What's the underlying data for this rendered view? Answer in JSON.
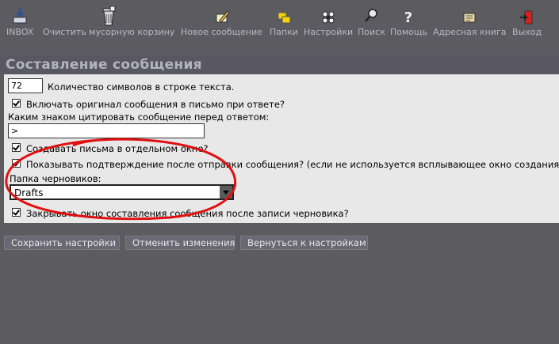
{
  "toolbar": {
    "items": [
      {
        "label": "INBOX",
        "icon": "inbox-icon"
      },
      {
        "label": "Очистить мусорную корзину",
        "icon": "trash-icon"
      },
      {
        "label": "Новое сообщение",
        "icon": "compose-icon"
      },
      {
        "label": "Папки",
        "icon": "folders-icon"
      },
      {
        "label": "Настройки",
        "icon": "settings-icon"
      },
      {
        "label": "Поиск",
        "icon": "search-icon"
      },
      {
        "label": "Помощь",
        "icon": "help-icon"
      },
      {
        "label": "Адресная книга",
        "icon": "addressbook-icon"
      },
      {
        "label": "Выход",
        "icon": "logout-icon"
      }
    ]
  },
  "section": {
    "title": "Составление сообщения"
  },
  "form": {
    "line_width_value": "72",
    "line_width_label": "Количество символов в строке текста.",
    "include_original_label": "Включать оригинал сообщения в письмо при ответе?",
    "quote_char_label": "Каким знаком цитировать сообщение перед ответом:",
    "quote_char_value": ">",
    "separate_window_label": "Создавать письма в отдельном окне?",
    "show_confirmation_label": "Показывать подтверждение после отправки сообщения? (если не используется всплывающее окно создания сообще",
    "drafts_folder_label": "Папка черновиков:",
    "drafts_folder_value": "Drafts",
    "close_after_save_label": "Закрывать окно составления сообщения после записи черновика?"
  },
  "buttons": {
    "save": "Сохранить настройки",
    "cancel": "Отменить изменения",
    "back": "Вернуться к настройкам"
  },
  "colors": {
    "background": "#5c5b60",
    "panel": "#e9e8e8",
    "annotation": "#e01010"
  }
}
